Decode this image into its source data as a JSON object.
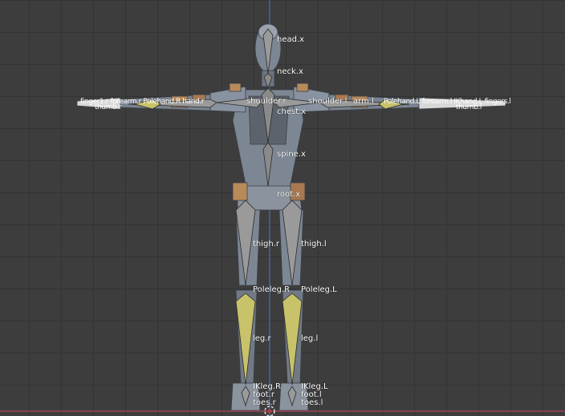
{
  "viewport": {
    "background": "#3d3d3d",
    "grid_color": "#333333",
    "axis_z_color": "#4a78c8",
    "axis_x_color": "#c8485a",
    "bone_selected_color": "#c8c36a",
    "bone_color": "#8a8a8a"
  },
  "bones": {
    "head": "head.x",
    "neck": "neck.x",
    "shoulder_r": "shoulder.r",
    "shoulder_l": "shoulder.l",
    "arm_l": "arm.l",
    "chest": "chest.x",
    "spine": "spine.x",
    "root": "root.x",
    "thigh_r": "thigh.r",
    "thigh_l": "thigh.l",
    "poleleg_r": "Poleleg.R",
    "poleleg_l": "Poleleg.L",
    "leg_r": "leg.r",
    "leg_l": "leg.l",
    "ikleg_r": "IKleg.R",
    "ikleg_l": "IKleg.L",
    "foot_r": "foot.r",
    "foot_l": "foot.l",
    "toes_r": "toes.r",
    "toes_l": "toes.l",
    "hand_left_cluster": "finger1.r forearm.r Polehand.R hand.r",
    "thumb_r": "thumb.r",
    "hand_right_cluster": "Polehand.L forearm.l IKhand.L fingers.l",
    "thumb_l": "thumb.l"
  }
}
